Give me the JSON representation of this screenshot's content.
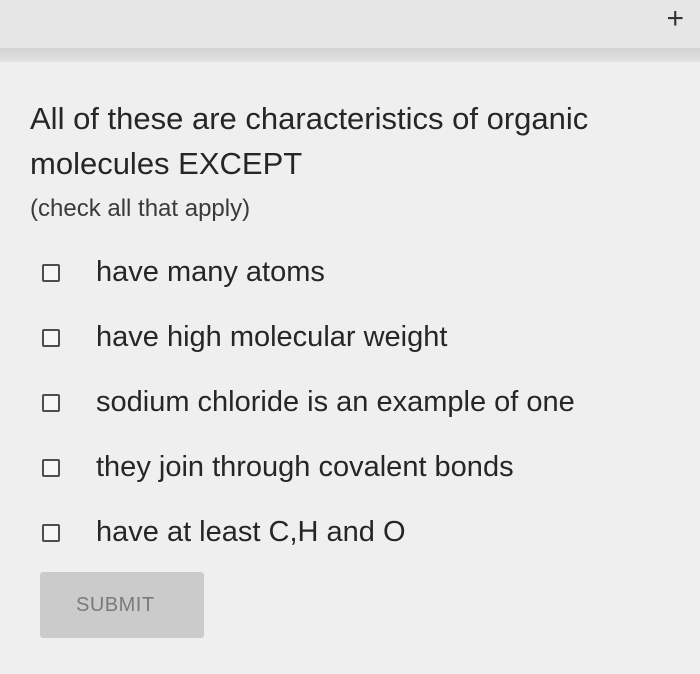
{
  "header": {
    "add_symbol": "+"
  },
  "question": {
    "text": "All of these are characteristics of organic molecules EXCEPT",
    "hint": "(check all that apply)"
  },
  "options": [
    {
      "label": "have many atoms",
      "checked": false
    },
    {
      "label": "have high molecular weight",
      "checked": false
    },
    {
      "label": "sodium chloride is an example of one",
      "checked": false
    },
    {
      "label": "they join through covalent bonds",
      "checked": false
    },
    {
      "label": "have at least C,H and O",
      "checked": false
    }
  ],
  "actions": {
    "submit_label": "SUBMIT"
  },
  "colors": {
    "background": "#efefef",
    "submit_background": "#cbcbcb",
    "submit_text": "#7a7a7a"
  }
}
